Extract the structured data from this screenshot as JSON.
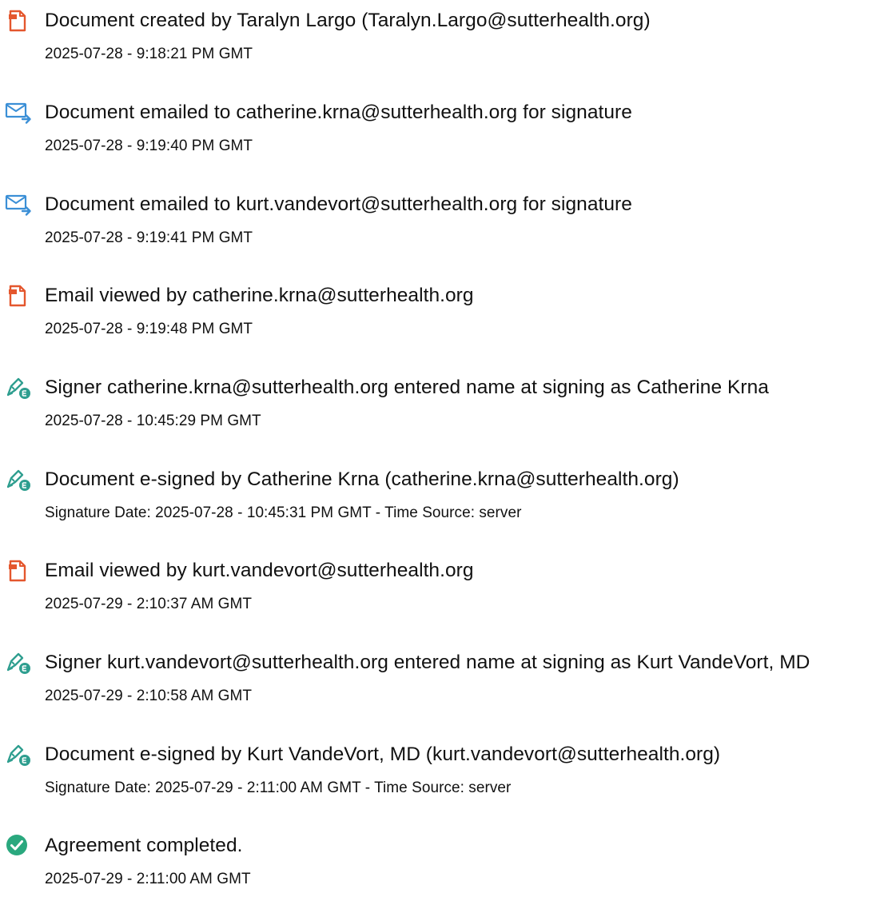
{
  "colors": {
    "doc_icon": "#e4572e",
    "email_icon": "#3b8fd6",
    "sign_icon": "#2e9e8f",
    "complete_icon": "#2aa87e",
    "text": "#111111"
  },
  "events": [
    {
      "icon": "document-icon",
      "title": "Document created by Taralyn Largo (Taralyn.Largo@sutterhealth.org)",
      "detail": "2025-07-28 - 9:18:21 PM GMT"
    },
    {
      "icon": "email-send-icon",
      "title": "Document emailed to catherine.krna@sutterhealth.org for signature",
      "detail": "2025-07-28 - 9:19:40 PM GMT"
    },
    {
      "icon": "email-send-icon",
      "title": "Document emailed to kurt.vandevort@sutterhealth.org for signature",
      "detail": "2025-07-28 - 9:19:41 PM GMT"
    },
    {
      "icon": "document-icon",
      "title": "Email viewed by catherine.krna@sutterhealth.org",
      "detail": "2025-07-28 - 9:19:48 PM GMT"
    },
    {
      "icon": "esign-pen-icon",
      "title": "Signer catherine.krna@sutterhealth.org entered name at signing as Catherine Krna",
      "detail": "2025-07-28 - 10:45:29 PM GMT"
    },
    {
      "icon": "esign-pen-icon",
      "title": "Document e-signed by Catherine Krna (catherine.krna@sutterhealth.org)",
      "detail": "Signature Date: 2025-07-28 - 10:45:31 PM GMT - Time Source: server"
    },
    {
      "icon": "document-icon",
      "title": "Email viewed by kurt.vandevort@sutterhealth.org",
      "detail": "2025-07-29 - 2:10:37 AM GMT"
    },
    {
      "icon": "esign-pen-icon",
      "title": "Signer kurt.vandevort@sutterhealth.org entered name at signing as Kurt VandeVort, MD",
      "detail": "2025-07-29 - 2:10:58 AM GMT"
    },
    {
      "icon": "esign-pen-icon",
      "title": "Document e-signed by Kurt VandeVort, MD (kurt.vandevort@sutterhealth.org)",
      "detail": "Signature Date: 2025-07-29 - 2:11:00 AM GMT - Time Source: server"
    },
    {
      "icon": "check-circle-icon",
      "title": "Agreement completed.",
      "detail": "2025-07-29 - 2:11:00 AM GMT"
    }
  ]
}
